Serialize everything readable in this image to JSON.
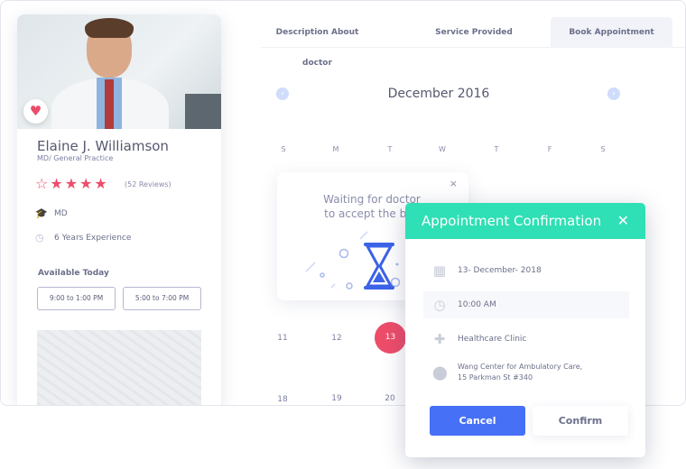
{
  "doctor": {
    "name": "Elaine J. Williamson",
    "specialty": "MD/ General Practice",
    "rating": 4,
    "rating_max": 5,
    "reviews": "(52 Reviews)",
    "degree": "MD",
    "experience": "6 Years Experience",
    "available_label": "Available Today",
    "slots": [
      "9:00 to 1:00 PM",
      "5:00 to 7:00 PM"
    ],
    "favorite_icon": "heart-icon"
  },
  "tabs": [
    {
      "label": "Description About doctor",
      "active": false
    },
    {
      "label": "Service Provided",
      "active": false
    },
    {
      "label": "Book Appointment",
      "active": true
    }
  ],
  "calendar": {
    "month": "December 2016",
    "weekdays": [
      "S",
      "M",
      "T",
      "W",
      "T",
      "F",
      "S"
    ],
    "days_row1": [
      "11",
      "12",
      "13"
    ],
    "days_row2": [
      "18",
      "19",
      "20"
    ],
    "selected": "13"
  },
  "waiting": {
    "text1": "Waiting for doctor",
    "text2": "to accept the boo",
    "close": "×"
  },
  "modal": {
    "title": "Appointment Confirmation",
    "close": "✕",
    "date": "13- December- 2018",
    "time": "10:00 AM",
    "clinic": "Healthcare Clinic",
    "address1": "Wang Center for Ambulatory Care,",
    "address2": "15 Parkman St #340",
    "cancel": "Cancel",
    "confirm": "Confirm"
  },
  "colors": {
    "accent": "#2fdfb5",
    "primary": "#4670f5",
    "highlight": "#ee4d6a"
  }
}
